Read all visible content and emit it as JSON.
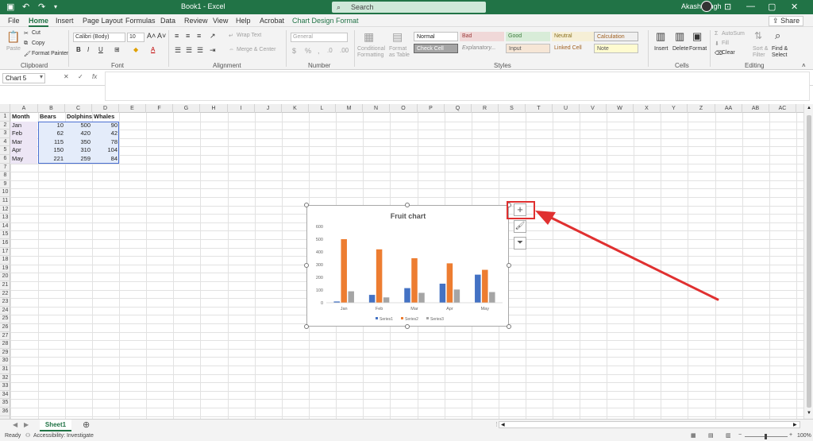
{
  "app": {
    "doc_title": "Book1  -  Excel",
    "search_placeholder": "Search",
    "user_name": "Akash Singh",
    "share_label": "Share"
  },
  "menu": {
    "tabs": [
      "File",
      "Home",
      "Insert",
      "Page Layout",
      "Formulas",
      "Data",
      "Review",
      "View",
      "Help",
      "Acrobat",
      "Chart Design",
      "Format"
    ]
  },
  "ribbon": {
    "clipboard": {
      "paste": "Paste",
      "cut": "Cut",
      "copy": "Copy",
      "format_painter": "Format Painter",
      "label": "Clipboard"
    },
    "font": {
      "font_name": "Calibri (Body)",
      "font_size": "10",
      "label": "Font"
    },
    "alignment": {
      "wrap_text": "Wrap Text",
      "merge_center": "Merge & Center",
      "label": "Alignment"
    },
    "number": {
      "format": "General",
      "label": "Number"
    },
    "styles": {
      "conditional": "Conditional Formatting",
      "format_table": "Format as Table",
      "normal": "Normal",
      "bad": "Bad",
      "good": "Good",
      "neutral": "Neutral",
      "calculation": "Calculation",
      "check_cell": "Check Cell",
      "explanatory": "Explanatory...",
      "input": "Input",
      "linked_cell": "Linked Cell",
      "note": "Note",
      "label": "Styles"
    },
    "cells": {
      "insert": "Insert",
      "delete": "Delete",
      "format": "Format",
      "label": "Cells"
    },
    "editing": {
      "autosum": "AutoSum",
      "fill": "Fill",
      "clear": "Clear",
      "sort_filter": "Sort & Filter",
      "find_select": "Find & Select",
      "label": "Editing"
    }
  },
  "formula_bar": {
    "name_box": "Chart 5",
    "fx": "fx"
  },
  "grid": {
    "columns": [
      "A",
      "B",
      "C",
      "D",
      "E",
      "F",
      "G",
      "H",
      "I",
      "J",
      "K",
      "L",
      "M",
      "N",
      "O",
      "P",
      "Q",
      "R",
      "S",
      "T",
      "U",
      "V",
      "W",
      "X",
      "Y",
      "Z",
      "AA",
      "AB",
      "AC"
    ],
    "rows": [
      "1",
      "2",
      "3",
      "4",
      "5",
      "6",
      "7",
      "8",
      "9",
      "10",
      "11",
      "12",
      "13",
      "14",
      "15",
      "16",
      "17",
      "18",
      "19",
      "20",
      "21",
      "22",
      "23",
      "24",
      "25",
      "26",
      "27",
      "28",
      "29",
      "30",
      "31",
      "32",
      "33",
      "34",
      "35",
      "36"
    ],
    "table_headers": [
      "Month",
      "Bears",
      "Dolphins",
      "Whales"
    ],
    "table_rows": [
      [
        "Jan",
        "10",
        "500",
        "90"
      ],
      [
        "Feb",
        "62",
        "420",
        "42"
      ],
      [
        "Mar",
        "115",
        "350",
        "78"
      ],
      [
        "Apr",
        "150",
        "310",
        "104"
      ],
      [
        "May",
        "221",
        "259",
        "84"
      ]
    ]
  },
  "chart_data": {
    "type": "bar",
    "title": "Fruit chart",
    "categories": [
      "Jan",
      "Feb",
      "Mar",
      "Apr",
      "May"
    ],
    "series": [
      {
        "name": "Series1",
        "values": [
          10,
          62,
          115,
          150,
          221
        ],
        "color": "#4472c4"
      },
      {
        "name": "Series2",
        "values": [
          500,
          420,
          350,
          310,
          259
        ],
        "color": "#ed7d31"
      },
      {
        "name": "Series3",
        "values": [
          90,
          42,
          78,
          104,
          84
        ],
        "color": "#a5a5a5"
      }
    ],
    "yticks": [
      "0",
      "100",
      "200",
      "300",
      "400",
      "500",
      "600"
    ],
    "ylim": [
      0,
      600
    ],
    "legend_position": "bottom",
    "grid": false
  },
  "sheet": {
    "tab": "Sheet1"
  },
  "status": {
    "ready": "Ready",
    "accessibility": "Accessibility: Investigate",
    "zoom": "100%"
  },
  "colors": {
    "excel_green": "#217346",
    "annotation_red": "#e03030"
  }
}
